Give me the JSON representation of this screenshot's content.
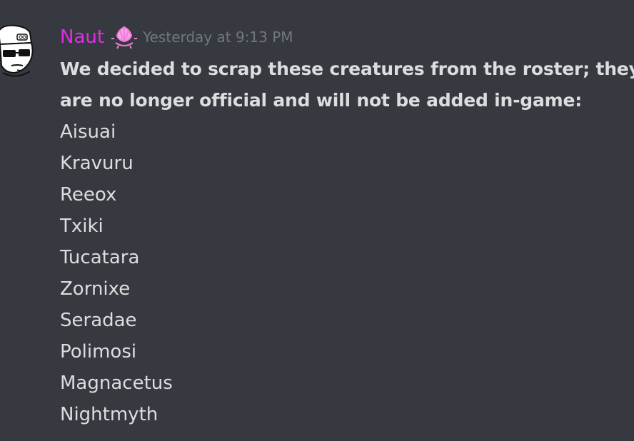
{
  "message": {
    "author": "Naut",
    "timestamp": "Yesterday at 9:13 PM",
    "role_icon": "pink-crystal-badge-icon",
    "avatar_icon": "sunglasses-character-avatar",
    "intro_lines": [
      "We decided to scrap these creatures from the roster; they",
      "are no longer official and will not be added in-game:"
    ],
    "creatures": [
      "Aisuai",
      "Kravuru",
      "Reeox",
      "Txiki",
      "Tucatara",
      "Zornixe",
      "Seradae",
      "Polimosi",
      "Magnacetus",
      "Nightmyth"
    ]
  },
  "colors": {
    "background": "#36393f",
    "username": "#e32de3",
    "text": "#dcddde",
    "timestamp": "#72767d",
    "role_icon": "#f27cd9"
  }
}
